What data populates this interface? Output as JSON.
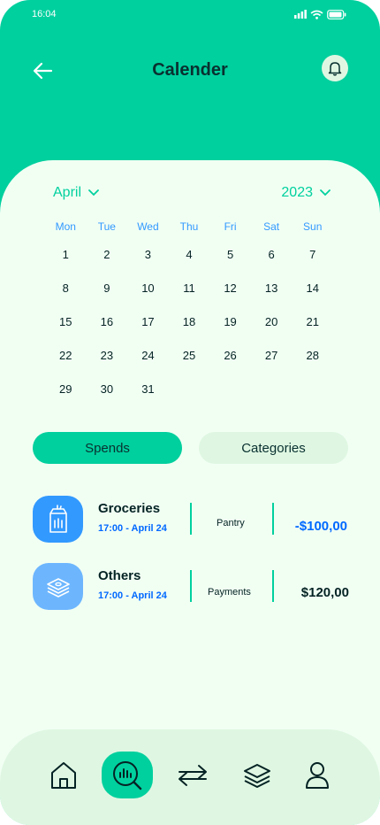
{
  "status": {
    "time": "16:04"
  },
  "header": {
    "title": "Calender"
  },
  "calendar": {
    "month": "April",
    "year": "2023",
    "weekdays": [
      "Mon",
      "Tue",
      "Wed",
      "Thu",
      "Fri",
      "Sat",
      "Sun"
    ],
    "weeks": [
      [
        "1",
        "2",
        "3",
        "4",
        "5",
        "6",
        "7"
      ],
      [
        "8",
        "9",
        "10",
        "11",
        "12",
        "13",
        "14"
      ],
      [
        "15",
        "16",
        "17",
        "18",
        "19",
        "20",
        "21"
      ],
      [
        "22",
        "23",
        "24",
        "25",
        "26",
        "27",
        "28"
      ],
      [
        "29",
        "30",
        "31",
        "",
        "",
        "",
        ""
      ]
    ]
  },
  "tabs": {
    "spends": "Spends",
    "categories": "Categories"
  },
  "transactions": [
    {
      "name": "Groceries",
      "time": "17:00 - April 24",
      "category": "Pantry",
      "amount": "-$100,00",
      "amount_color": "#0068FF",
      "icon": "grocery-bag-icon",
      "icon_bg": "#3299FF"
    },
    {
      "name": "Others",
      "time": "17:00 - April 24",
      "category": "Payments",
      "amount": "$120,00",
      "amount_color": "#052224",
      "icon": "money-stack-icon",
      "icon_bg": "#6DB6FE"
    }
  ],
  "nav": [
    "home-icon",
    "analysis-icon",
    "transactions-icon",
    "categories-icon",
    "profile-icon"
  ],
  "colors": {
    "primary": "#00D09E",
    "background": "#F1FFF3",
    "surface": "#DFF7E2",
    "text": "#093030",
    "accent": "#0068FF"
  }
}
